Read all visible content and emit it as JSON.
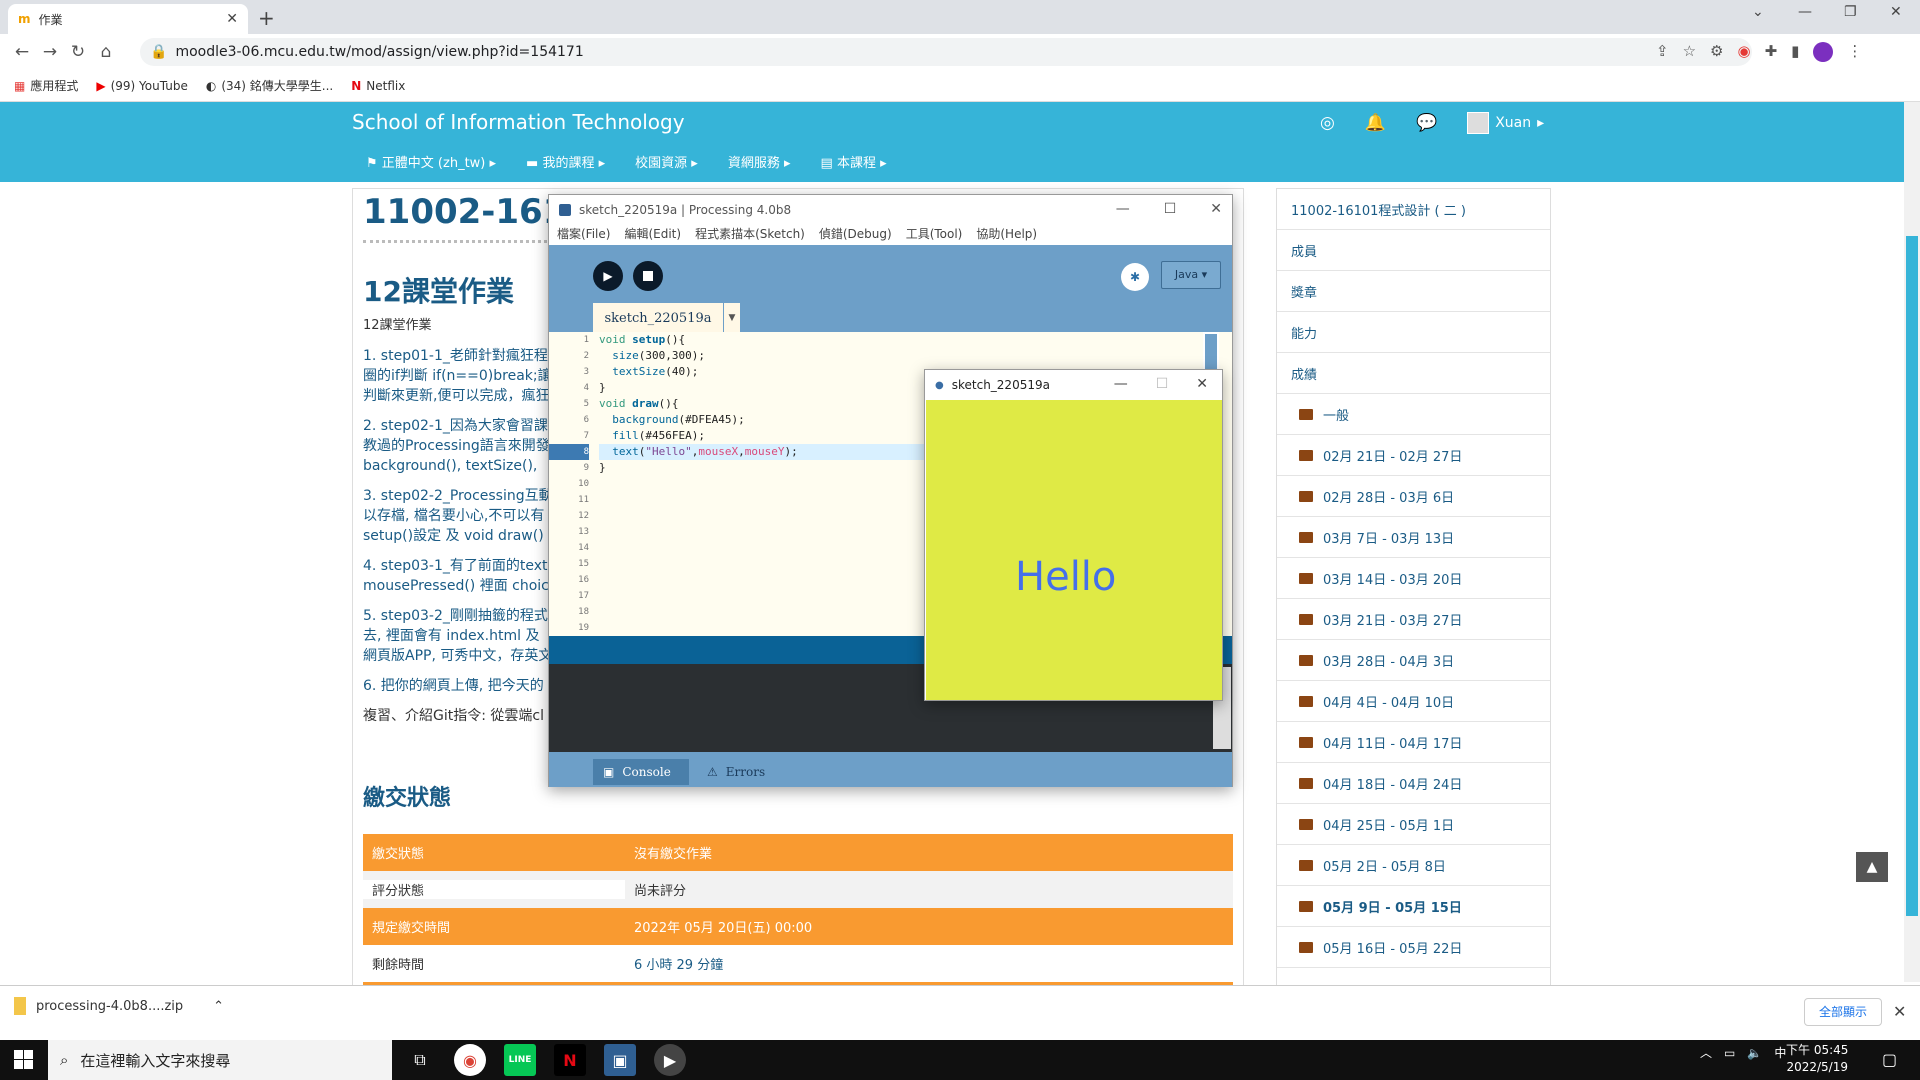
{
  "browser": {
    "tab_title": "作業",
    "url": "moodle3-06.mcu.edu.tw/mod/assign/view.php?id=154171",
    "bookmarks": [
      "應用程式",
      "(99) YouTube",
      "(34) 銘傳大學學生...",
      "Netflix"
    ]
  },
  "moodle": {
    "site_name": "School of Information Technology",
    "nav": [
      "正體中文 (zh_tw)",
      "我的課程",
      "校園資源",
      "資網服務",
      "本課程"
    ],
    "user": "Xuan",
    "course_title": "11002-161",
    "assignment_title": "12課堂作業",
    "intro": "12課堂作業",
    "paragraphs": [
      [
        "1. step01-1_老師針對瘋狂程",
        "圈的if判斷 if(n==0)break;讓",
        "判斷來更新,便可以完成，瘋狂"
      ],
      [
        "2. step02-1_因為大家會習課",
        "教過的Processing語言來開發",
        "background(), textSize(), "
      ],
      [
        "3. step02-2_Processing互動",
        "以存檔, 檔名要小心,不可以有",
        "setup()設定 及 void draw()"
      ],
      [
        "4. step03-1_有了前面的text",
        "mousePressed() 裡面 choic"
      ],
      [
        "5. step03-2_剛剛抽籤的程式",
        "去, 裡面會有 index.html 及",
        "網頁版APP, 可秀中文，存英文"
      ],
      [
        "6. 把你的網頁上傳, 把今天的"
      ],
      [
        "複習、介紹Git指令: 從雲端cl"
      ]
    ],
    "submission_heading": "繳交狀態",
    "status_rows": [
      {
        "label": "繳交狀態",
        "value": "沒有繳交作業"
      },
      {
        "label": "評分狀態",
        "value": "尚未評分"
      },
      {
        "label": "規定繳交時間",
        "value": "2022年 05月 20日(五) 00:00"
      },
      {
        "label": "剩餘時間",
        "value": "6 小時 29 分鐘"
      }
    ],
    "sidebar": [
      "11002-16101程式設計 ( 二 )",
      "成員",
      "獎章",
      "能力",
      "成績"
    ],
    "sections": [
      "一般",
      "02月 21日 - 02月 27日",
      "02月 28日 - 03月 6日",
      "03月 7日 - 03月 13日",
      "03月 14日 - 03月 20日",
      "03月 21日 - 03月 27日",
      "03月 28日 - 04月 3日",
      "04月 4日 - 04月 10日",
      "04月 11日 - 04月 17日",
      "04月 18日 - 04月 24日",
      "04月 25日 - 05月 1日",
      "05月 2日 - 05月 8日",
      "05月 9日 - 05月 15日",
      "05月 16日 - 05月 22日"
    ]
  },
  "processing": {
    "window_title": "sketch_220519a | Processing 4.0b8",
    "menu": [
      "檔案(File)",
      "編輯(Edit)",
      "程式素描本(Sketch)",
      "偵錯(Debug)",
      "工具(Tool)",
      "協助(Help)"
    ],
    "mode": "Java ▾",
    "tab": "sketch_220519a",
    "line_numbers": [
      "1",
      "2",
      "3",
      "4",
      "5",
      "6",
      "7",
      "8",
      "9",
      "10",
      "11",
      "12",
      "13",
      "14",
      "15",
      "16",
      "17",
      "18",
      "19"
    ],
    "console_tab": "Console",
    "errors_tab": "Errors"
  },
  "sketch": {
    "window_title": "sketch_220519a",
    "text": "Hello",
    "background": "#dfea45",
    "fill": "#456fea"
  },
  "downloads": {
    "file": "processing-4.0b8....zip",
    "show_all": "全部顯示"
  },
  "taskbar": {
    "search_placeholder": "在這裡輸入文字來搜尋",
    "ime": "中",
    "time": "下午 05:45",
    "date": "2022/5/19"
  }
}
